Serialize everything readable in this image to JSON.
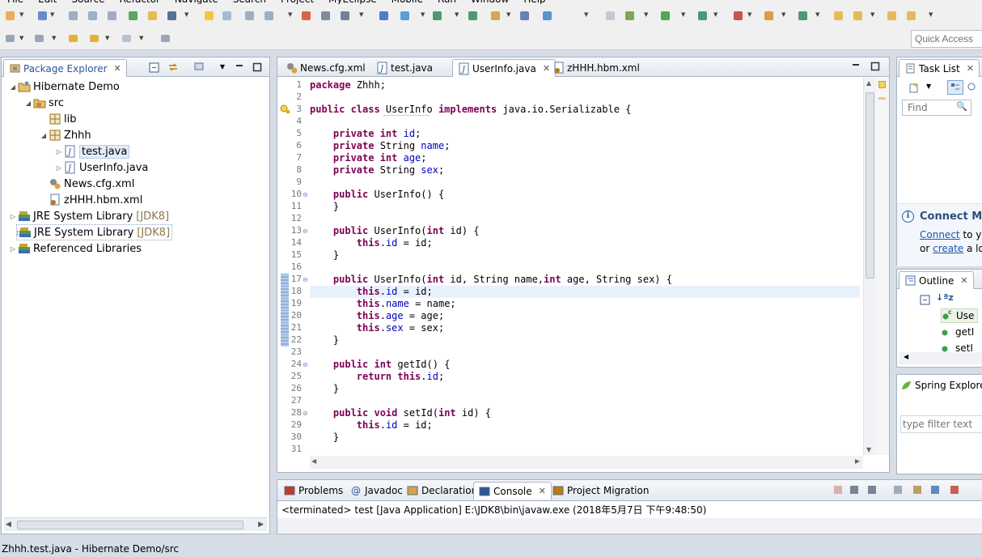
{
  "menu": [
    "File",
    "Edit",
    "Source",
    "Refactor",
    "Navigate",
    "Search",
    "Project",
    "MyEclipse",
    "Mobile",
    "Run",
    "Window",
    "Help"
  ],
  "quick_access": {
    "placeholder": "Quick Access"
  },
  "package_explorer": {
    "title": "Package Explorer",
    "tree": [
      {
        "label": "Hibernate Demo",
        "icon": "project-icon",
        "level": 0,
        "twisty": "open"
      },
      {
        "label": "src",
        "icon": "source-folder-icon",
        "level": 1,
        "twisty": "open"
      },
      {
        "label": "lib",
        "icon": "package-icon",
        "level": 2,
        "twisty": ""
      },
      {
        "label": "Zhhh",
        "icon": "package-icon",
        "level": 2,
        "twisty": "open"
      },
      {
        "label": "test.java",
        "icon": "java-file-icon",
        "level": 3,
        "twisty": "closed",
        "selected": true
      },
      {
        "label": "UserInfo.java",
        "icon": "java-file-icon",
        "level": 3,
        "twisty": "closed"
      },
      {
        "label": "News.cfg.xml",
        "icon": "xml-config-icon",
        "level": 2,
        "twisty": ""
      },
      {
        "label": "zHHH.hbm.xml",
        "icon": "xml-mapping-icon",
        "level": 2,
        "twisty": ""
      },
      {
        "label": "JRE System Library",
        "suffix": "[JDK8]",
        "icon": "library-icon",
        "level": 0,
        "twisty": "closed"
      },
      {
        "label": "JRE System Library",
        "suffix": "[JDK8]",
        "icon": "library-icon",
        "level": 0,
        "twisty": "closed",
        "outlined": true
      },
      {
        "label": "Referenced Libraries",
        "icon": "library-icon",
        "level": 0,
        "twisty": "closed"
      }
    ]
  },
  "editor": {
    "tabs": [
      {
        "label": "News.cfg.xml",
        "icon": "xml-config-icon"
      },
      {
        "label": "test.java",
        "icon": "java-file-icon"
      },
      {
        "label": "UserInfo.java",
        "icon": "java-file-icon",
        "active": true,
        "close": "✕"
      },
      {
        "label": "zHHH.hbm.xml",
        "icon": "xml-mapping-icon"
      }
    ],
    "lines": [
      [
        {
          "t": "package ",
          "c": "kw"
        },
        {
          "t": "Zhhh;"
        }
      ],
      [],
      [
        {
          "t": "public class ",
          "c": "kw"
        },
        {
          "t": "UserInfo "
        },
        {
          "t": "implements ",
          "c": "kw"
        },
        {
          "t": "java.io.Serializable {"
        }
      ],
      [],
      [
        {
          "t": "    "
        },
        {
          "t": "private int ",
          "c": "kw"
        },
        {
          "t": "id",
          "c": "fld"
        },
        {
          "t": ";"
        }
      ],
      [
        {
          "t": "    "
        },
        {
          "t": "private ",
          "c": "kw"
        },
        {
          "t": "String "
        },
        {
          "t": "name",
          "c": "fld"
        },
        {
          "t": ";"
        }
      ],
      [
        {
          "t": "    "
        },
        {
          "t": "private int ",
          "c": "kw"
        },
        {
          "t": "age",
          "c": "fld"
        },
        {
          "t": ";"
        }
      ],
      [
        {
          "t": "    "
        },
        {
          "t": "private ",
          "c": "kw"
        },
        {
          "t": "String "
        },
        {
          "t": "sex",
          "c": "fld"
        },
        {
          "t": ";"
        }
      ],
      [],
      [
        {
          "t": "    "
        },
        {
          "t": "public ",
          "c": "kw"
        },
        {
          "t": "UserInfo() {"
        }
      ],
      [
        {
          "t": "    }"
        }
      ],
      [],
      [
        {
          "t": "    "
        },
        {
          "t": "public ",
          "c": "kw"
        },
        {
          "t": "UserInfo("
        },
        {
          "t": "int ",
          "c": "kw"
        },
        {
          "t": "id) {"
        }
      ],
      [
        {
          "t": "        "
        },
        {
          "t": "this",
          "c": "kw"
        },
        {
          "t": "."
        },
        {
          "t": "id",
          "c": "fld"
        },
        {
          "t": " = id;"
        }
      ],
      [
        {
          "t": "    }"
        }
      ],
      [],
      [
        {
          "t": "    "
        },
        {
          "t": "public ",
          "c": "kw"
        },
        {
          "t": "UserInfo("
        },
        {
          "t": "int ",
          "c": "kw"
        },
        {
          "t": "id, String name,"
        },
        {
          "t": "int ",
          "c": "kw"
        },
        {
          "t": "age, String sex) {"
        }
      ],
      [
        {
          "t": "        "
        },
        {
          "t": "this",
          "c": "kw"
        },
        {
          "t": "."
        },
        {
          "t": "id",
          "c": "fld"
        },
        {
          "t": " = id;"
        }
      ],
      [
        {
          "t": "        "
        },
        {
          "t": "this",
          "c": "kw"
        },
        {
          "t": "."
        },
        {
          "t": "name",
          "c": "fld"
        },
        {
          "t": " = name;"
        }
      ],
      [
        {
          "t": "        "
        },
        {
          "t": "this",
          "c": "kw"
        },
        {
          "t": "."
        },
        {
          "t": "age",
          "c": "fld"
        },
        {
          "t": " = age;"
        }
      ],
      [
        {
          "t": "        "
        },
        {
          "t": "this",
          "c": "kw"
        },
        {
          "t": "."
        },
        {
          "t": "sex",
          "c": "fld"
        },
        {
          "t": " = sex;"
        }
      ],
      [
        {
          "t": "    }"
        }
      ],
      [],
      [
        {
          "t": "    "
        },
        {
          "t": "public int ",
          "c": "kw"
        },
        {
          "t": "getId() {"
        }
      ],
      [
        {
          "t": "        "
        },
        {
          "t": "return this",
          "c": "kw"
        },
        {
          "t": "."
        },
        {
          "t": "id",
          "c": "fld"
        },
        {
          "t": ";"
        }
      ],
      [
        {
          "t": "    }"
        }
      ],
      [],
      [
        {
          "t": "    "
        },
        {
          "t": "public void ",
          "c": "kw"
        },
        {
          "t": "setId("
        },
        {
          "t": "int ",
          "c": "kw"
        },
        {
          "t": "id) {"
        }
      ],
      [
        {
          "t": "        "
        },
        {
          "t": "this",
          "c": "kw"
        },
        {
          "t": "."
        },
        {
          "t": "id",
          "c": "fld"
        },
        {
          "t": " = id;"
        }
      ],
      [
        {
          "t": "    }"
        }
      ],
      []
    ],
    "fold_lines": [
      10,
      13,
      17,
      24,
      28
    ],
    "highlight_line": 18
  },
  "task_list": {
    "title": "Task List",
    "find_placeholder": "Find",
    "connect_heading": "Connect My",
    "connect_link": "Connect",
    "connect_text": " to yo",
    "create_prefix": "or ",
    "create_link": "create",
    "create_text": " a lo"
  },
  "outline": {
    "title": "Outline",
    "items": [
      {
        "label": "Use",
        "icon": "class-icon"
      },
      {
        "label": "getI",
        "icon": "method-icon"
      },
      {
        "label": "setI",
        "icon": "method-icon"
      }
    ]
  },
  "spring": {
    "title": "Spring Explorer",
    "filter_placeholder": "type filter text"
  },
  "bottom": {
    "tabs": [
      {
        "label": "Problems",
        "icon": "problems-icon"
      },
      {
        "label": "Javadoc",
        "icon": "javadoc-icon"
      },
      {
        "label": "Declaration",
        "icon": "declaration-icon"
      },
      {
        "label": "Console",
        "icon": "console-icon",
        "active": true,
        "close": "✕"
      },
      {
        "label": "Project Migration",
        "icon": "migration-icon"
      }
    ],
    "console_text": "<terminated> test [Java Application] E:\\JDK8\\bin\\javaw.exe (2018年5月7日 下午9:48:50)"
  },
  "status": "Zhhh.test.java - Hibernate Demo/src"
}
